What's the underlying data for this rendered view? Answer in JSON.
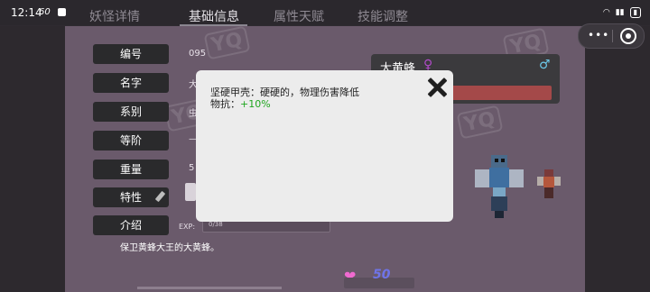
{
  "status": {
    "time": "12:14",
    "speed": "60"
  },
  "tabs": [
    "妖怪详情",
    "基础信息",
    "属性天赋",
    "技能调整"
  ],
  "fields": {
    "id": {
      "label": "编号",
      "value": "095"
    },
    "name": {
      "label": "名字",
      "value": "大"
    },
    "system": {
      "label": "系别",
      "value": "虫"
    },
    "level": {
      "label": "等阶",
      "value": "—"
    },
    "weight": {
      "label": "重量",
      "value": "5"
    },
    "trait": {
      "label": "特性"
    },
    "intro": {
      "label": "介绍"
    }
  },
  "exp": {
    "label": "EXP:",
    "value": "0/38"
  },
  "description": "保卫黄蜂大王的大黄蜂。",
  "monster_name": "大黄蜂",
  "heart_value": "50",
  "popup": {
    "line1": "坚硬甲壳：硬硬的，物理伤害降低",
    "line2_label": "物抗：",
    "line2_value": "+10%"
  },
  "watermark": "YQ"
}
